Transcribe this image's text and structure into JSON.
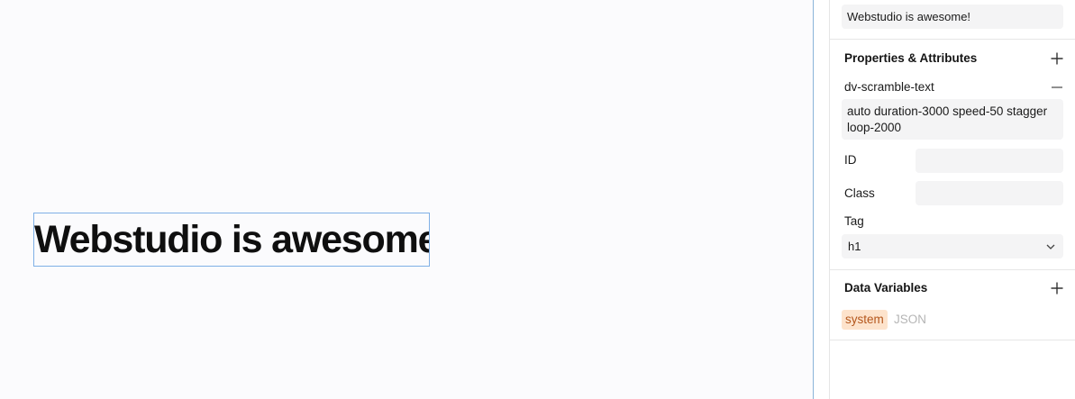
{
  "canvas": {
    "heading_text": "Webstudio is awesome!"
  },
  "panel": {
    "text_content_value": "Webstudio is awesome!",
    "properties": {
      "title": "Properties & Attributes",
      "add_icon": "plus-icon",
      "attribute": {
        "name": "dv-scramble-text",
        "remove_icon": "minus-icon",
        "value": "auto duration-3000 speed-50 stagger loop-2000"
      },
      "id_label": "ID",
      "id_value": "",
      "class_label": "Class",
      "class_value": "",
      "tag_label": "Tag",
      "tag_value": "h1",
      "tag_icon": "chevron-down-icon"
    },
    "data_variables": {
      "title": "Data Variables",
      "add_icon": "plus-icon",
      "items": [
        {
          "name": "system",
          "type": "JSON"
        }
      ]
    }
  },
  "colors": {
    "selection_outline": "#7fb0e6",
    "canvas_bg": "#fbfbfd",
    "field_bg": "#f4f4f5",
    "badge_bg": "#fde3cc",
    "badge_text": "#b4561c",
    "muted_text": "#b5b5b5"
  }
}
